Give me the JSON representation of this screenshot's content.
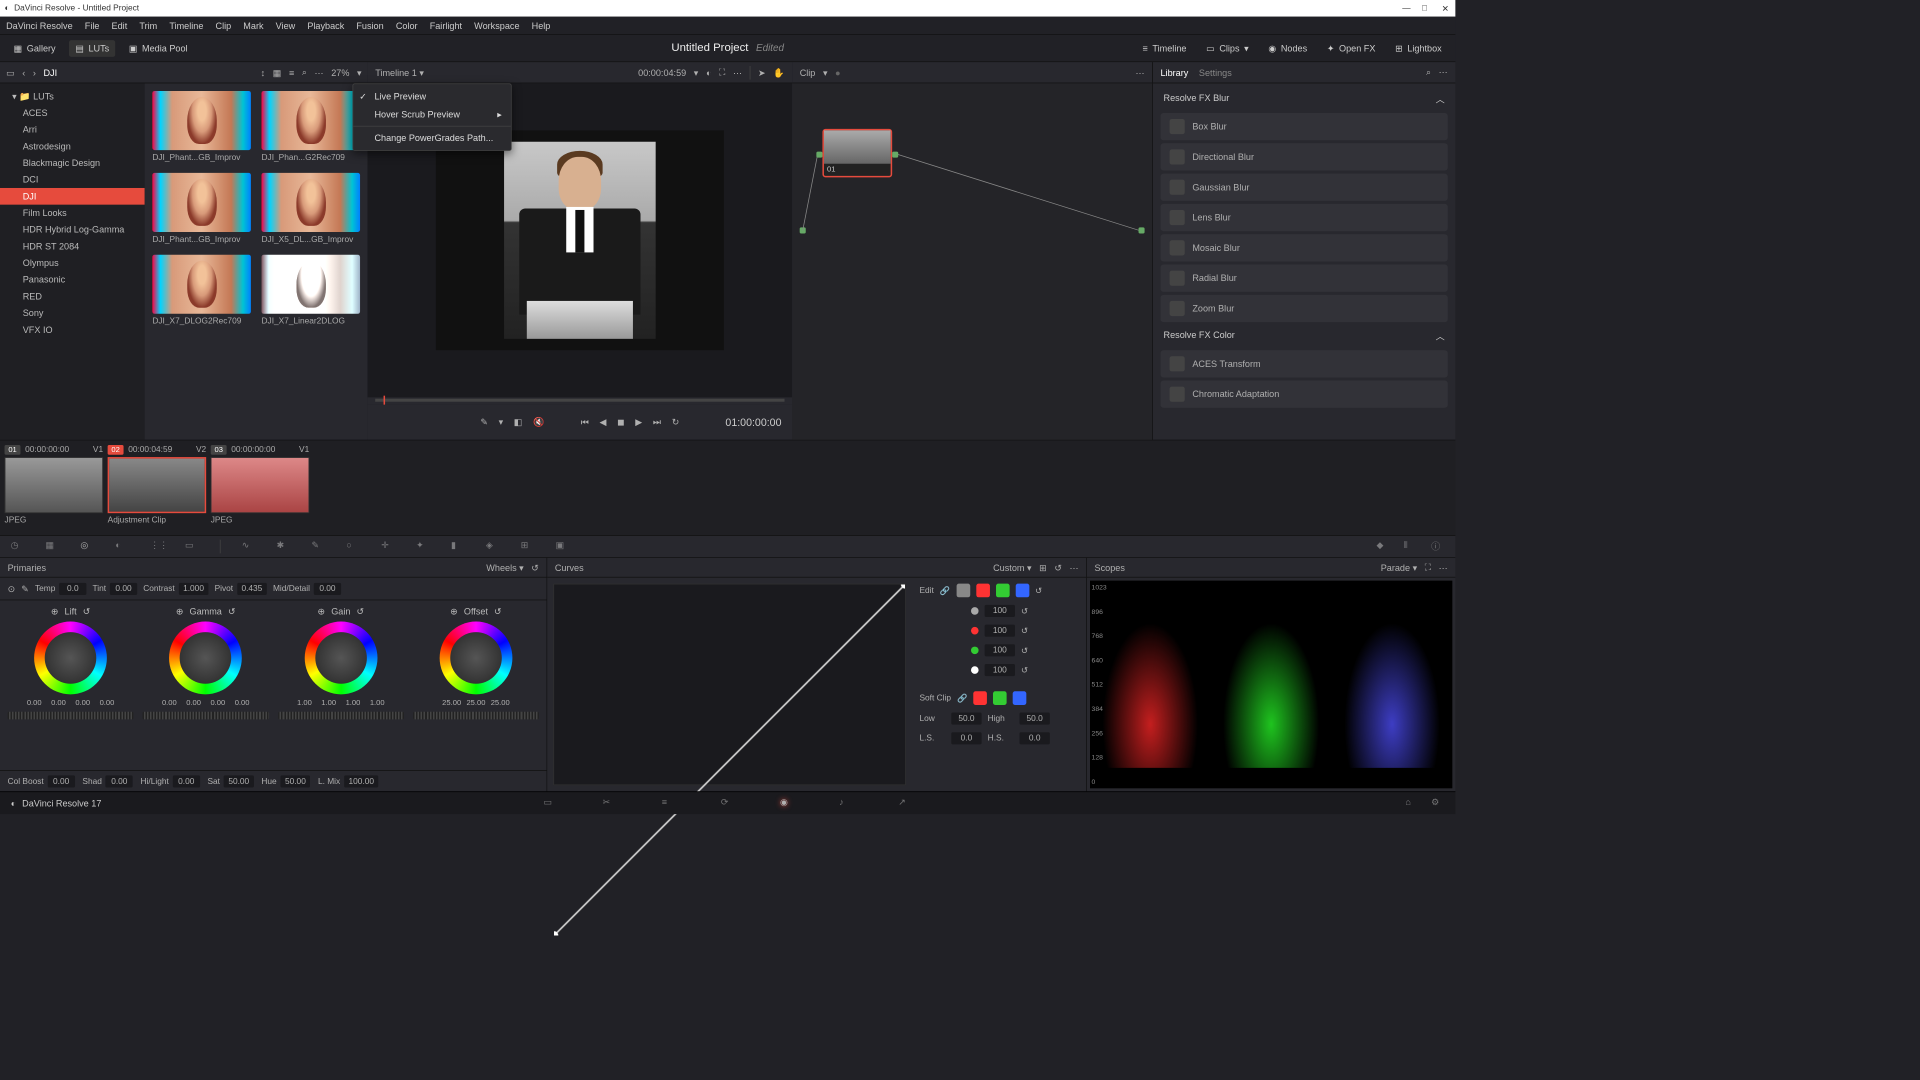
{
  "window_title": "DaVinci Resolve - Untitled Project",
  "menubar": [
    "DaVinci Resolve",
    "File",
    "Edit",
    "Trim",
    "Timeline",
    "Clip",
    "Mark",
    "View",
    "Playback",
    "Fusion",
    "Color",
    "Fairlight",
    "Workspace",
    "Help"
  ],
  "toolbar": {
    "gallery": "Gallery",
    "luts": "LUTs",
    "media_pool": "Media Pool",
    "timeline": "Timeline",
    "clips": "Clips",
    "nodes": "Nodes",
    "openfx": "Open FX",
    "lightbox": "Lightbox"
  },
  "project": {
    "name": "Untitled Project",
    "status": "Edited"
  },
  "lut_panel": {
    "title": "DJI",
    "zoom": "27%",
    "tree_root": "LUTs",
    "tree": [
      "ACES",
      "Arri",
      "Astrodesign",
      "Blackmagic Design",
      "DCI",
      "DJI",
      "Film Looks",
      "HDR Hybrid Log-Gamma",
      "HDR ST 2084",
      "Olympus",
      "Panasonic",
      "RED",
      "Sony",
      "VFX IO"
    ],
    "selected": "DJI",
    "thumbs": [
      "DJI_Phant...GB_Improv",
      "DJI_Phan...G2Rec709",
      "DJI_Phant...GB_Improv",
      "DJI_X5_DL...GB_Improv",
      "DJI_X7_DLOG2Rec709",
      "DJI_X7_Linear2DLOG"
    ]
  },
  "context_menu": {
    "items": [
      "Live Preview",
      "Hover Scrub Preview",
      "Change PowerGrades Path..."
    ],
    "checked": 0,
    "submenu": 1
  },
  "viewer": {
    "timeline_label": "Timeline 1",
    "timecode_head": "00:00:04:59",
    "timecode_play": "01:00:00:00"
  },
  "node": {
    "label": "Clip",
    "node_num": "01"
  },
  "library": {
    "tabs": [
      "Library",
      "Settings"
    ],
    "sections": [
      {
        "title": "Resolve FX Blur",
        "items": [
          "Box Blur",
          "Directional Blur",
          "Gaussian Blur",
          "Lens Blur",
          "Mosaic Blur",
          "Radial Blur",
          "Zoom Blur"
        ]
      },
      {
        "title": "Resolve FX Color",
        "items": [
          "ACES Transform",
          "Chromatic Adaptation"
        ]
      }
    ]
  },
  "clips": [
    {
      "num": "01",
      "tc": "00:00:00:00",
      "track": "V1",
      "label": "JPEG"
    },
    {
      "num": "02",
      "tc": "00:00:04:59",
      "track": "V2",
      "label": "Adjustment Clip"
    },
    {
      "num": "03",
      "tc": "00:00:00:00",
      "track": "V1",
      "label": "JPEG"
    }
  ],
  "primaries": {
    "title": "Primaries",
    "mode": "Wheels",
    "top_adj": [
      {
        "l": "Temp",
        "v": "0.0"
      },
      {
        "l": "Tint",
        "v": "0.00"
      },
      {
        "l": "Contrast",
        "v": "1.000"
      },
      {
        "l": "Pivot",
        "v": "0.435"
      },
      {
        "l": "Mid/Detail",
        "v": "0.00"
      }
    ],
    "wheels": [
      {
        "name": "Lift",
        "vals": [
          "0.00",
          "0.00",
          "0.00",
          "0.00"
        ]
      },
      {
        "name": "Gamma",
        "vals": [
          "0.00",
          "0.00",
          "0.00",
          "0.00"
        ]
      },
      {
        "name": "Gain",
        "vals": [
          "1.00",
          "1.00",
          "1.00",
          "1.00"
        ]
      },
      {
        "name": "Offset",
        "vals": [
          "25.00",
          "25.00",
          "25.00"
        ]
      }
    ],
    "bottom_adj": [
      {
        "l": "Col Boost",
        "v": "0.00"
      },
      {
        "l": "Shad",
        "v": "0.00"
      },
      {
        "l": "Hi/Light",
        "v": "0.00"
      },
      {
        "l": "Sat",
        "v": "50.00"
      },
      {
        "l": "Hue",
        "v": "50.00"
      },
      {
        "l": "L. Mix",
        "v": "100.00"
      }
    ]
  },
  "curves": {
    "title": "Curves",
    "mode": "Custom",
    "edit_label": "Edit",
    "channels": [
      {
        "c": "#aaa",
        "v": "100"
      },
      {
        "c": "#f33",
        "v": "100"
      },
      {
        "c": "#3c3",
        "v": "100"
      },
      {
        "c": "#fff",
        "v": "100"
      }
    ],
    "softclip_label": "Soft Clip",
    "softclip": [
      {
        "l": "Low",
        "v": "50.0"
      },
      {
        "l": "High",
        "v": "50.0"
      },
      {
        "l": "L.S.",
        "v": "0.0"
      },
      {
        "l": "H.S.",
        "v": "0.0"
      }
    ]
  },
  "scopes": {
    "title": "Scopes",
    "mode": "Parade",
    "labels": [
      "1023",
      "896",
      "768",
      "640",
      "512",
      "384",
      "256",
      "128",
      "0"
    ]
  },
  "footer": {
    "app": "DaVinci Resolve 17"
  }
}
